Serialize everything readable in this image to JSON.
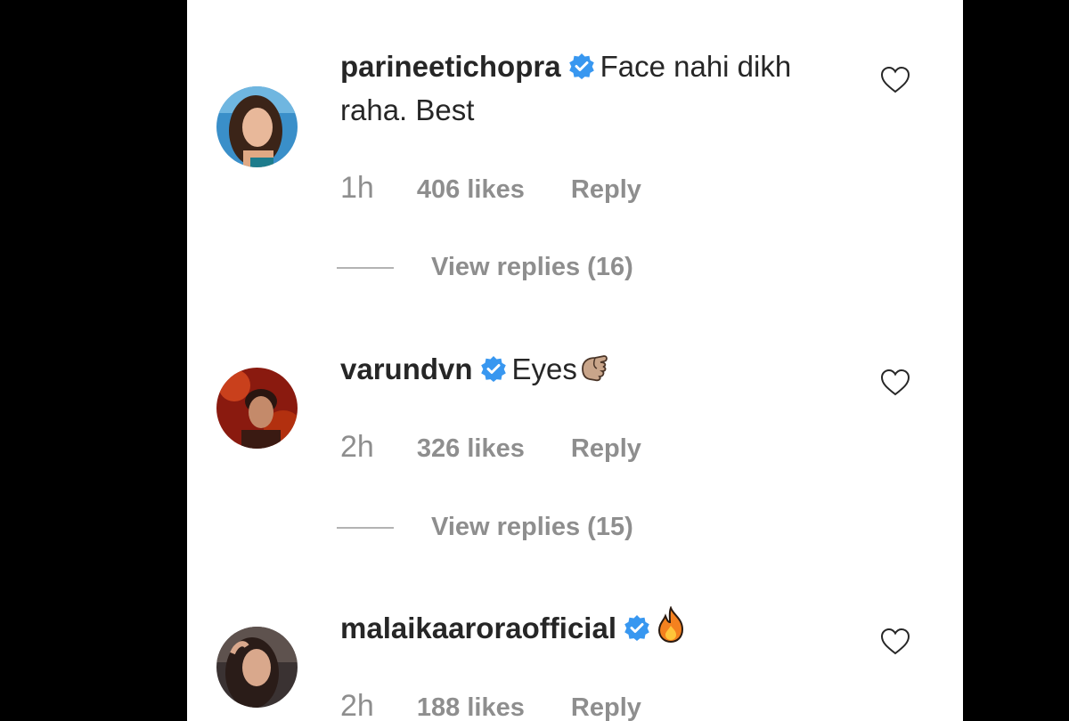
{
  "comments": [
    {
      "username": "parineetichopra",
      "verified": true,
      "text_line1": "Face nahi dikh",
      "text_line2": "raha. Best",
      "time": "1h",
      "likes": "406 likes",
      "reply": "Reply",
      "view_replies": "View replies (16)"
    },
    {
      "username": "varundvn",
      "verified": true,
      "text_line1": "Eyes",
      "emoji": "hand-gesture-emoji",
      "time": "2h",
      "likes": "326 likes",
      "reply": "Reply",
      "view_replies": "View replies (15)"
    },
    {
      "username": "malaikaaroraofficial",
      "verified": true,
      "emoji": "fire-emoji",
      "time": "2h",
      "likes": "188 likes",
      "reply": "Reply"
    }
  ],
  "colors": {
    "verified_blue": "#3897f0",
    "secondary_text": "#8e8e8e",
    "primary_text": "#262626"
  }
}
